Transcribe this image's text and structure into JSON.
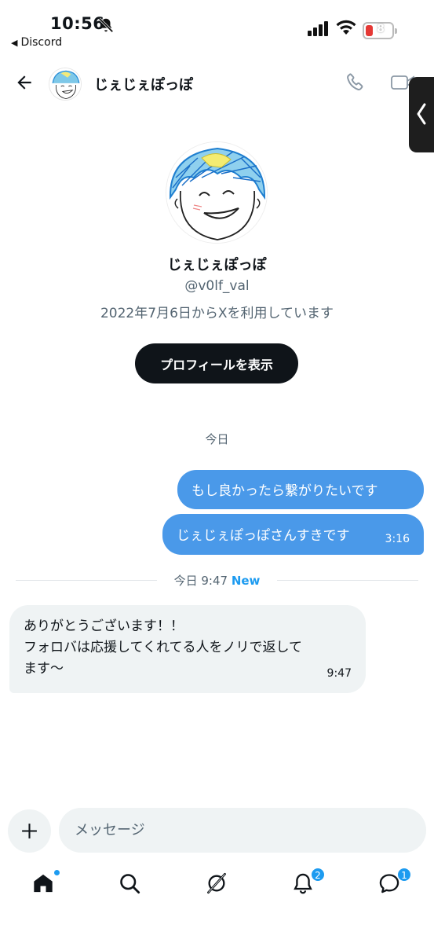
{
  "status_bar": {
    "time": "10:56",
    "back_app": "Discord",
    "battery": "8"
  },
  "header": {
    "name": "じぇじぇぽっぽ"
  },
  "profile": {
    "name": "じぇじぇぽっぽ",
    "handle": "@v0lf_val",
    "joined": "2022年7月6日からXを利用しています",
    "button_label": "プロフィールを表示"
  },
  "conversation": {
    "date_label": "今日",
    "sent": [
      {
        "text": "もし良かったら繋がりたいです",
        "time": ""
      },
      {
        "text": "じぇじぇぽっぽさんすきです",
        "time": "3:16"
      }
    ],
    "divider": {
      "label": "今日 9:47",
      "new_label": "New"
    },
    "received": {
      "line1": "ありがとうございます！！",
      "line2": "フォロバは応援してくれてる人をノリで返して",
      "line3": "ます〜",
      "time": "9:47"
    }
  },
  "composer": {
    "placeholder": "メッセージ"
  },
  "nav": {
    "notifications_badge": "2",
    "messages_badge": "1"
  },
  "colors": {
    "sent_bubble": "#4a99e9",
    "received_bubble": "#eff3f4",
    "accent": "#1d9bf0",
    "primary_button": "#0f1419"
  }
}
